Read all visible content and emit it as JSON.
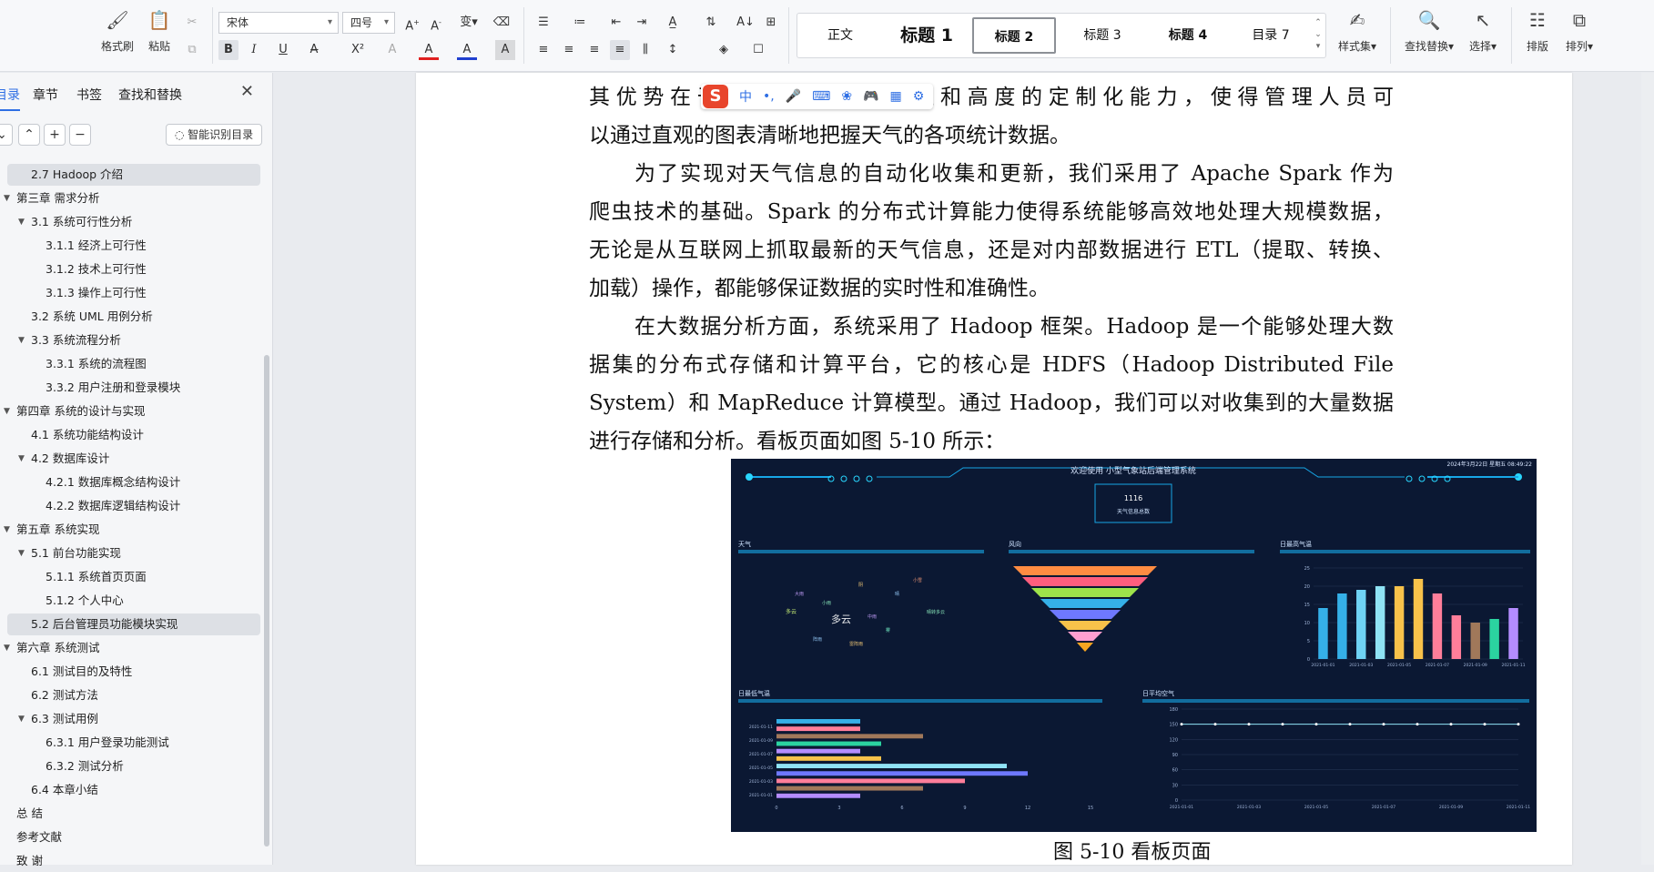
{
  "ribbon": {
    "format_painter": "格式刷",
    "paste": "粘贴",
    "font_name": "宋体",
    "font_size": "四号",
    "styles": [
      "正文",
      "标题 1",
      "标题 2",
      "标题 3",
      "标题 4",
      "目录 7"
    ],
    "style_set": "样式集",
    "find_replace": "查找替换",
    "select": "选择",
    "layout": "排版",
    "arrange": "排列"
  },
  "nav": {
    "tabs": [
      "目录",
      "章节",
      "书签",
      "查找和替换"
    ],
    "smart_toc": "智能识别目录",
    "toc": [
      {
        "label": "2.7 Hadoop 介绍",
        "level": 2,
        "arrow": false,
        "highlight": true
      },
      {
        "label": "第三章 需求分析",
        "level": 1,
        "arrow": true
      },
      {
        "label": "3.1 系统可行性分析",
        "level": 2,
        "arrow": true
      },
      {
        "label": "3.1.1 经济上可行性",
        "level": 3,
        "arrow": false
      },
      {
        "label": "3.1.2 技术上可行性",
        "level": 3,
        "arrow": false
      },
      {
        "label": "3.1.3 操作上可行性",
        "level": 3,
        "arrow": false
      },
      {
        "label": "3.2 系统 UML 用例分析",
        "level": 2,
        "arrow": false
      },
      {
        "label": "3.3 系统流程分析",
        "level": 2,
        "arrow": true
      },
      {
        "label": "3.3.1 系统的流程图",
        "level": 3,
        "arrow": false
      },
      {
        "label": "3.3.2 用户注册和登录模块",
        "level": 3,
        "arrow": false
      },
      {
        "label": "第四章 系统的设计与实现",
        "level": 1,
        "arrow": true
      },
      {
        "label": "4.1 系统功能结构设计",
        "level": 2,
        "arrow": false
      },
      {
        "label": "4.2 数据库设计",
        "level": 2,
        "arrow": true
      },
      {
        "label": "4.2.1 数据库概念结构设计",
        "level": 3,
        "arrow": false
      },
      {
        "label": "4.2.2 数据库逻辑结构设计",
        "level": 3,
        "arrow": false
      },
      {
        "label": "第五章 系统实现",
        "level": 1,
        "arrow": true
      },
      {
        "label": "5.1 前台功能实现",
        "level": 2,
        "arrow": true
      },
      {
        "label": "5.1.1 系统首页页面",
        "level": 3,
        "arrow": false
      },
      {
        "label": "5.1.2 个人中心",
        "level": 3,
        "arrow": false
      },
      {
        "label": "5.2 后台管理员功能模块实现",
        "level": 2,
        "arrow": false,
        "highlight": true
      },
      {
        "label": "第六章 系统测试",
        "level": 1,
        "arrow": true
      },
      {
        "label": "6.1 测试目的及特性",
        "level": 2,
        "arrow": false
      },
      {
        "label": "6.2 测试方法",
        "level": 2,
        "arrow": false
      },
      {
        "label": "6.3 测试用例",
        "level": 2,
        "arrow": true
      },
      {
        "label": "6.3.1 用户登录功能测试",
        "level": 3,
        "arrow": false
      },
      {
        "label": "6.3.2 测试分析",
        "level": 3,
        "arrow": false
      },
      {
        "label": "6.4 本章小结",
        "level": 2,
        "arrow": false
      },
      {
        "label": "总 结",
        "level": 1,
        "arrow": false
      },
      {
        "label": "参考文献",
        "level": 1,
        "arrow": false
      },
      {
        "label": "致 谢",
        "level": 1,
        "arrow": false
      }
    ]
  },
  "doc": {
    "para1": [
      "其优势在于其丰富的图表类型和高度的定制化能力，使得管理人员可",
      "以通过直观的图表清晰地把握天气的各项统计数据。"
    ],
    "para2": [
      "为了实现对天气信息的自动化收集和更新，我们采用了 Apache Spark 作为",
      "爬虫技术的基础。Spark 的分布式计算能力使得系统能够高效地处理大规模数据，",
      "无论是从互联网上抓取最新的天气信息，还是对内部数据进行 ETL（提取、转换、",
      "加载）操作，都能够保证数据的实时性和准确性。"
    ],
    "para3": [
      "在大数据分析方面，系统采用了 Hadoop 框架。Hadoop 是一个能够处理大数",
      "据集的分布式存储和计算平台，它的核心是 HDFS（Hadoop Distributed File",
      "System）和 MapReduce 计算模型。通过 Hadoop，我们可以对收集到的大量数据",
      "进行存储和分析。看板页面如图 5-10 所示："
    ],
    "caption": "图 5-10 看板页面",
    "ime_label": "中"
  },
  "dashboard": {
    "title": "欢迎使用 小型气象站后端管理系统",
    "datetime": "2024年3月22日 星期五 08:49:22",
    "total_value": "1116",
    "total_label": "天气信息总数",
    "panel_weather": "天气",
    "panel_wind": "风向",
    "panel_max_temp": "日最高气温",
    "panel_min_temp": "日最低气温",
    "panel_avg_air": "日平均空气",
    "colors": {
      "bg": "#0b1833",
      "accent": "#17a6e6",
      "cyan": "#29d6ff"
    }
  },
  "chart_data": [
    {
      "type": "bar",
      "title": "日最高气温",
      "categories": [
        "2021-01-01",
        "",
        "2021-01-03",
        "",
        "2021-01-05",
        "",
        "2021-01-07",
        "",
        "2021-01-09",
        "",
        "2021-01-11"
      ],
      "values": [
        14,
        18,
        19,
        20,
        20,
        22,
        18,
        12,
        10,
        11,
        14
      ],
      "ylim": [
        0,
        25
      ],
      "yticks": [
        0,
        5,
        10,
        15,
        20,
        25
      ]
    },
    {
      "type": "bar",
      "orientation": "horizontal",
      "title": "日最低气温",
      "categories": [
        "2021-01-01",
        "2021-01-03",
        "2021-01-05",
        "2021-01-07",
        "2021-01-09",
        "2021-01-11"
      ],
      "values": [
        4,
        7,
        9,
        12,
        11,
        5,
        4,
        5,
        7,
        4,
        4
      ],
      "xticks": [
        0,
        3,
        6,
        9,
        12,
        15
      ]
    },
    {
      "type": "line",
      "title": "日平均空气",
      "x": [
        "2021-01-01",
        "2021-01-03",
        "2021-01-05",
        "2021-01-07",
        "2021-01-09",
        "2021-01-11"
      ],
      "values": [
        150,
        150,
        150,
        150,
        150,
        150,
        150,
        150,
        150,
        150,
        150
      ],
      "yticks": [
        0,
        30,
        60,
        90,
        120,
        150,
        180
      ],
      "ylim": [
        0,
        180
      ]
    }
  ]
}
